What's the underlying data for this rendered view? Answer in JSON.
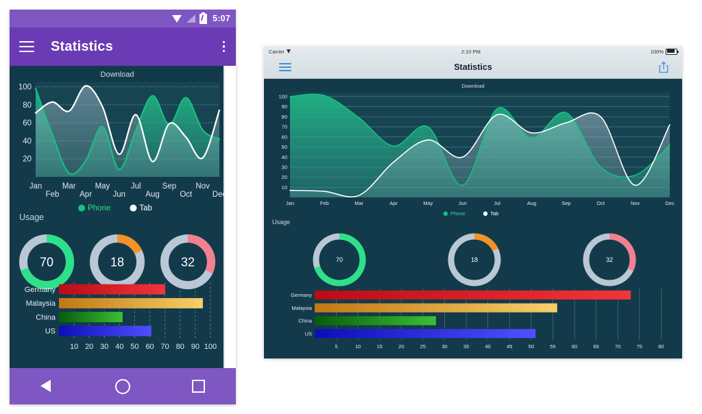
{
  "phone": {
    "status_bar": {
      "time": "5:07",
      "icons": [
        "wifi-icon",
        "signal-icon",
        "battery-charging-icon"
      ]
    },
    "app_bar": {
      "menu_icon": "hamburger-menu-icon",
      "title": "Statistics",
      "overflow_icon": "kebab-menu-icon"
    },
    "nav_bar": {
      "back": "back-triangle-icon",
      "home": "home-circle-icon",
      "recents": "recents-square-icon"
    },
    "usage_label": "Usage",
    "theme": {
      "accent_purple": "#6a3bb5",
      "status_purple": "#7e57c2",
      "card_bg": "#123a4b",
      "green": "#2ee08a",
      "white": "#ffffff"
    }
  },
  "tablet": {
    "status_bar": {
      "carrier": "Carrier",
      "time": "2:10 PM",
      "battery": "100%"
    },
    "app_bar": {
      "menu_icon": "hamburger-menu-icon",
      "title": "Statistics",
      "share_icon": "share-icon"
    },
    "usage_label": "Usage"
  },
  "chart_data": [
    {
      "id": "phone-download",
      "type": "area",
      "title": "Download",
      "xlabel": "",
      "ylabel": "",
      "categories": [
        "Jan",
        "Feb",
        "Mar",
        "Apr",
        "May",
        "Jun",
        "Jul",
        "Aug",
        "Sep",
        "Oct",
        "Nov",
        "Dec"
      ],
      "yticks": [
        20,
        40,
        60,
        80,
        100
      ],
      "ylim": [
        0,
        105
      ],
      "grid": true,
      "legend": [
        "Phone",
        "Tab"
      ],
      "legend_position": "bottom",
      "series": [
        {
          "name": "Phone",
          "color": "#17c07e",
          "values": [
            98,
            47,
            4,
            18,
            56,
            8,
            52,
            90,
            58,
            88,
            52,
            42
          ]
        },
        {
          "name": "Tab",
          "color": "#ffffff",
          "values": [
            71,
            83,
            73,
            101,
            78,
            25,
            69,
            17,
            59,
            44,
            21,
            74
          ]
        }
      ]
    },
    {
      "id": "phone-usage-donuts",
      "type": "pie",
      "title": "Usage",
      "values": [
        70,
        18,
        32
      ],
      "labels": [
        "70",
        "18",
        "32"
      ],
      "colors": [
        "#2ee08a",
        "#f39325",
        "#f3808e"
      ],
      "track_color": "#b9c8d4"
    },
    {
      "id": "phone-countries",
      "type": "bar",
      "orientation": "horizontal",
      "categories": [
        "Germany",
        "Malaysia",
        "China",
        "US"
      ],
      "values": [
        70,
        95,
        42,
        61
      ],
      "xticks": [
        10,
        20,
        30,
        40,
        50,
        60,
        70,
        80,
        90,
        100
      ],
      "xlim": [
        0,
        105
      ],
      "colors": [
        "#d81219",
        "#d68516",
        "#0a6b11",
        "#1212d8"
      ],
      "colors_light": [
        "#f5333c",
        "#f5c55a",
        "#35ae2e",
        "#4a4afc"
      ],
      "title": "",
      "grid": true
    },
    {
      "id": "tablet-download",
      "type": "area",
      "title": "Download",
      "xlabel": "",
      "ylabel": "",
      "categories": [
        "Jan",
        "Feb",
        "Mar",
        "Apr",
        "May",
        "Jun",
        "Jul",
        "Aug",
        "Sep",
        "Oct",
        "Nov",
        "Dec"
      ],
      "yticks": [
        10,
        20,
        30,
        40,
        50,
        60,
        70,
        80,
        90,
        100
      ],
      "ylim": [
        0,
        104
      ],
      "grid": true,
      "legend": [
        "Phone",
        "Tab"
      ],
      "legend_position": "bottom",
      "series": [
        {
          "name": "Phone",
          "color": "#17c07e",
          "values": [
            100,
            101,
            79,
            51,
            70,
            12,
            88,
            59,
            84,
            30,
            22,
            52
          ]
        },
        {
          "name": "Tab",
          "color": "#ffffff",
          "values": [
            7,
            6,
            2,
            35,
            57,
            40,
            82,
            64,
            74,
            80,
            12,
            72
          ]
        }
      ]
    },
    {
      "id": "tablet-usage-donuts",
      "type": "pie",
      "title": "Usage",
      "values": [
        70,
        18,
        32
      ],
      "labels": [
        "70",
        "18",
        "32"
      ],
      "colors": [
        "#2ee08a",
        "#f39325",
        "#f3808e"
      ],
      "track_color": "#b9c8d4"
    },
    {
      "id": "tablet-countries",
      "type": "bar",
      "orientation": "horizontal",
      "categories": [
        "Germany",
        "Malaysia",
        "China",
        "US"
      ],
      "values": [
        73,
        56,
        28,
        51
      ],
      "xticks": [
        5,
        10,
        15,
        20,
        25,
        30,
        35,
        40,
        45,
        50,
        55,
        60,
        65,
        70,
        75,
        80
      ],
      "xlim": [
        0,
        82
      ],
      "colors": [
        "#d81219",
        "#d68516",
        "#0a6b11",
        "#1212d8"
      ],
      "colors_light": [
        "#f5333c",
        "#f5c55a",
        "#35ae2e",
        "#4a4afc"
      ],
      "title": "",
      "grid": true
    }
  ]
}
